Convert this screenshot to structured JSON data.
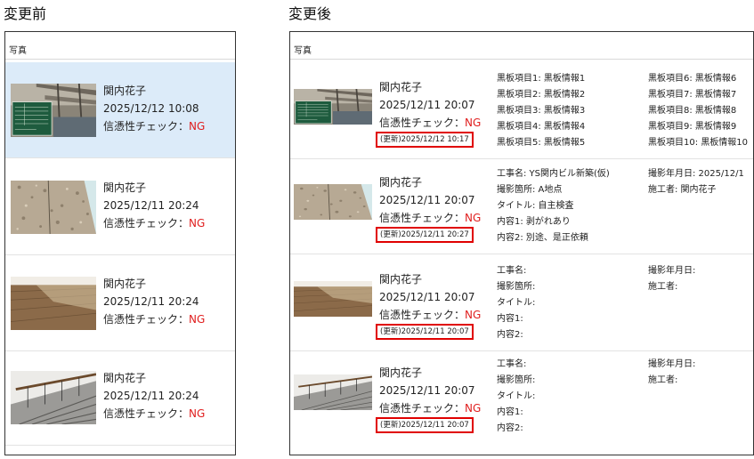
{
  "before": {
    "heading": "変更前",
    "panel_label": "写真",
    "rows": [
      {
        "user": "関内花子",
        "date": "2025/12/12 10:08",
        "check_label": "信憑性チェック：",
        "check_value": "NG",
        "thumb": "construction-blackboard-photo",
        "highlighted": true
      },
      {
        "user": "関内花子",
        "date": "2025/12/11 20:24",
        "check_label": "信憑性チェック：",
        "check_value": "NG",
        "thumb": "concrete-wall-photo",
        "highlighted": false
      },
      {
        "user": "関内花子",
        "date": "2025/12/11 20:24",
        "check_label": "信憑性チェック：",
        "check_value": "NG",
        "thumb": "wood-floor-photo",
        "highlighted": false
      },
      {
        "user": "関内花子",
        "date": "2025/12/11 20:24",
        "check_label": "信憑性チェック：",
        "check_value": "NG",
        "thumb": "staircase-photo",
        "highlighted": false
      }
    ]
  },
  "after": {
    "heading": "変更後",
    "panel_label": "写真",
    "rows": [
      {
        "user": "関内花子",
        "date": "2025/12/11 20:07",
        "check_label": "信憑性チェック：",
        "check_value": "NG",
        "updated": "(更新)2025/12/12 10:17",
        "thumb": "construction-blackboard-photo",
        "col1": [
          "黒板項目1: 黒板情報1",
          "黒板項目2: 黒板情報2",
          "黒板項目3: 黒板情報3",
          "黒板項目4: 黒板情報4",
          "黒板項目5: 黒板情報5"
        ],
        "col2": [
          "黒板項目6: 黒板情報6",
          "黒板項目7: 黒板情報7",
          "黒板項目8: 黒板情報8",
          "黒板項目9: 黒板情報9",
          "黒板項目10: 黒板情報10"
        ]
      },
      {
        "user": "関内花子",
        "date": "2025/12/11 20:07",
        "check_label": "信憑性チェック：",
        "check_value": "NG",
        "updated": "(更新)2025/12/11 20:27",
        "thumb": "concrete-wall-photo",
        "col1": [
          "工事名: YS関内ビル新築(仮)",
          "撮影箇所: A地点",
          "タイトル: 自主検査",
          "内容1: 剥がれあり",
          "内容2: 別途、是正依頼"
        ],
        "col2": [
          "撮影年月日: 2025/12/1",
          "施工者: 関内花子"
        ]
      },
      {
        "user": "関内花子",
        "date": "2025/12/11 20:07",
        "check_label": "信憑性チェック：",
        "check_value": "NG",
        "updated": "(更新)2025/12/11 20:07",
        "thumb": "wood-floor-photo",
        "col1": [
          "工事名:",
          "撮影箇所:",
          "タイトル:",
          "内容1:",
          "内容2:"
        ],
        "col2": [
          "撮影年月日:",
          "施工者:"
        ]
      },
      {
        "user": "関内花子",
        "date": "2025/12/11 20:07",
        "check_label": "信憑性チェック：",
        "check_value": "NG",
        "updated": "(更新)2025/12/11 20:07",
        "thumb": "staircase-photo",
        "col1": [
          "工事名:",
          "撮影箇所:",
          "タイトル:",
          "内容1:",
          "内容2:"
        ],
        "col2": [
          "撮影年月日:",
          "施工者:"
        ]
      }
    ]
  },
  "colors": {
    "ng": "#e01e1e",
    "highlight": "#dcebf9",
    "update_border": "#e00000"
  }
}
